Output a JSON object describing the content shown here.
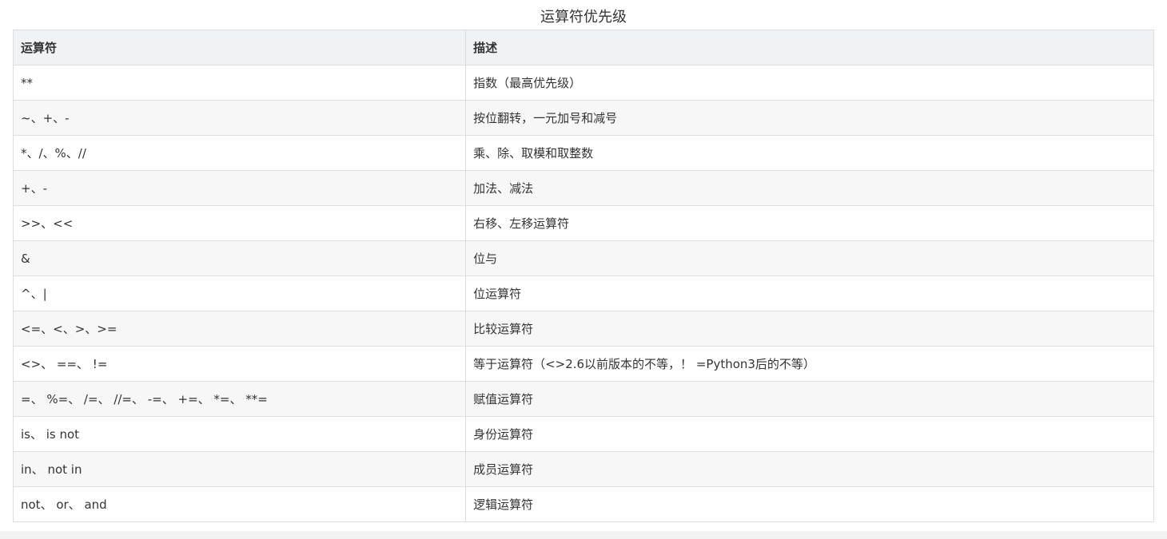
{
  "caption": "运算符优先级",
  "table": {
    "headers": [
      "运算符",
      "描述"
    ],
    "rows": [
      [
        "**",
        "指数（最高优先级）"
      ],
      [
        "~、+、-",
        "按位翻转，一元加号和减号"
      ],
      [
        "*、/、%、//",
        "乘、除、取模和取整数"
      ],
      [
        "+、-",
        "加法、减法"
      ],
      [
        ">>、<<",
        "右移、左移运算符"
      ],
      [
        "&",
        "位与"
      ],
      [
        "^、|",
        "位运算符"
      ],
      [
        "<=、<、>、>=",
        "比较运算符"
      ],
      [
        "<>、 ==、 !=",
        "等于运算符（<>2.6以前版本的不等，！ =Python3后的不等）"
      ],
      [
        "=、 %=、 /=、 //=、 -=、 +=、 *=、 **=",
        "赋值运算符"
      ],
      [
        "is、 is not",
        "身份运算符"
      ],
      [
        "in、 not in",
        "成员运算符"
      ],
      [
        "not、 or、 and",
        "逻辑运算符"
      ]
    ]
  }
}
